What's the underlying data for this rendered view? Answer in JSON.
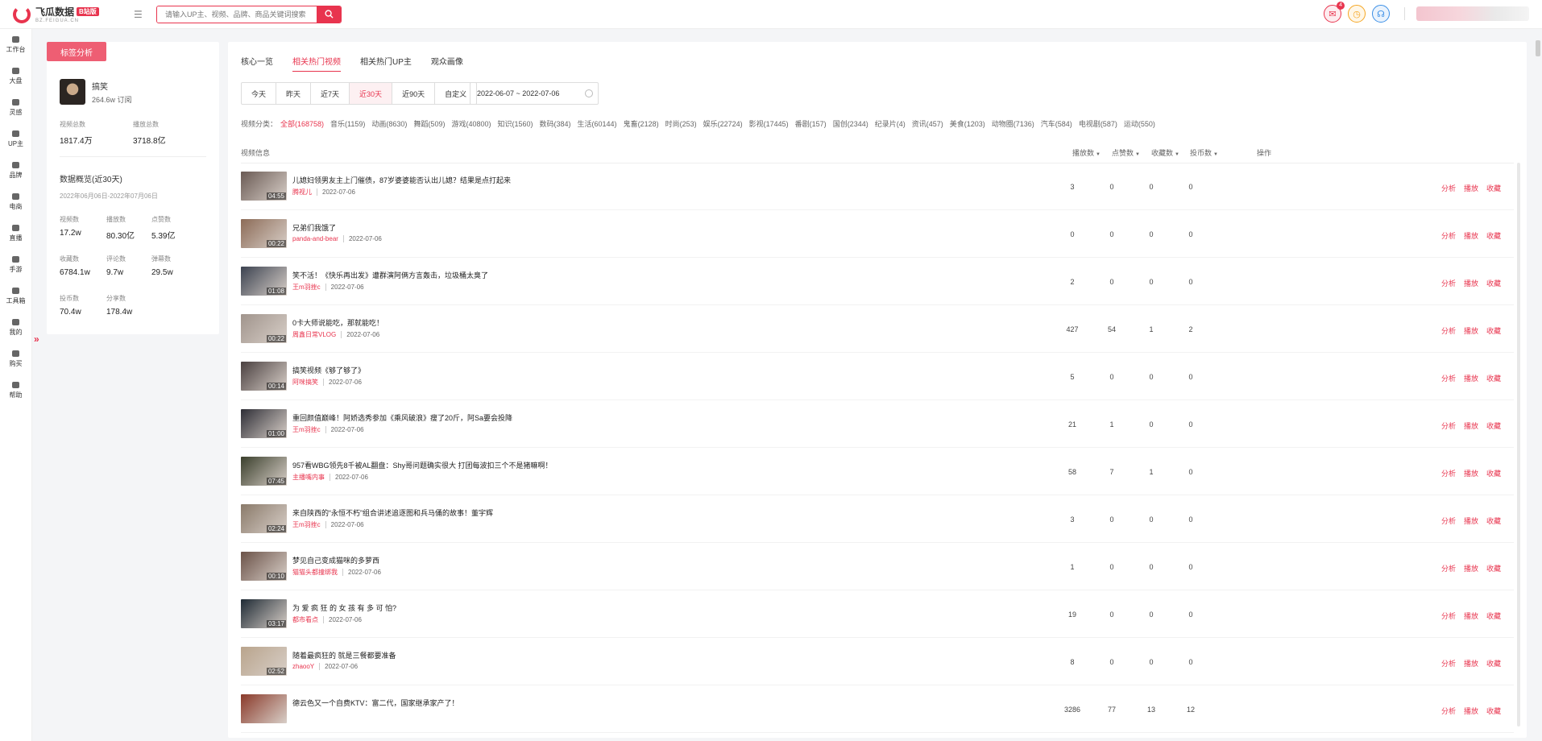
{
  "app": {
    "name": "飞瓜数据",
    "badge": "B站版",
    "domain": "BZ.FEIGUA.CN"
  },
  "search": {
    "placeholder": "请输入UP主、视频、品牌、商品关键词搜索"
  },
  "header": {
    "notif_count": "4"
  },
  "nav": [
    {
      "label": "工作台",
      "icon": "desk-icon"
    },
    {
      "label": "大盘",
      "icon": "globe-icon"
    },
    {
      "label": "灵感",
      "icon": "bulb-icon"
    },
    {
      "label": "UP主",
      "icon": "search-user-icon"
    },
    {
      "label": "品牌",
      "icon": "diamond-icon"
    },
    {
      "label": "电商",
      "icon": "cart-icon"
    },
    {
      "label": "直播",
      "icon": "live-icon"
    },
    {
      "label": "手游",
      "icon": "gamepad-icon"
    },
    {
      "label": "工具箱",
      "icon": "toolbox-icon"
    },
    {
      "label": "我的",
      "icon": "user-icon"
    },
    {
      "label": "购买",
      "icon": "purchase-icon"
    },
    {
      "label": "帮助",
      "icon": "help-icon"
    }
  ],
  "left": {
    "tag_tab": "标签分析",
    "up_name": "搞笑",
    "up_fans": "264.6w 订阅",
    "totals": [
      {
        "key": "视频总数",
        "val": "1817.4万"
      },
      {
        "key": "播放总数",
        "val": "3718.8亿"
      }
    ],
    "overview_title": "数据概览(近30天)",
    "overview_range": "2022年06月06日-2022年07月06日",
    "stats": [
      {
        "key": "视频数",
        "val": "17.2w"
      },
      {
        "key": "播放数",
        "val": "80.30亿"
      },
      {
        "key": "点赞数",
        "val": "5.39亿"
      },
      {
        "key": "收藏数",
        "val": "6784.1w"
      },
      {
        "key": "评论数",
        "val": "9.7w"
      },
      {
        "key": "弹幕数",
        "val": "29.5w"
      },
      {
        "key": "投币数",
        "val": "70.4w"
      },
      {
        "key": "分享数",
        "val": "178.4w"
      }
    ]
  },
  "main": {
    "tabs": [
      "核心一览",
      "相关热门视频",
      "相关热门UP主",
      "观众画像"
    ],
    "active_tab": 1,
    "date_buttons": [
      "今天",
      "昨天",
      "近7天",
      "近30天",
      "近90天",
      "自定义"
    ],
    "active_date": 3,
    "date_range": "2022-06-07 ~ 2022-07-06",
    "category_label": "视频分类：",
    "categories": [
      "全部(168758)",
      "音乐(1159)",
      "动画(8630)",
      "舞蹈(509)",
      "游戏(40800)",
      "知识(1560)",
      "数码(384)",
      "生活(60144)",
      "鬼畜(2128)",
      "时尚(253)",
      "娱乐(22724)",
      "影视(17445)",
      "番剧(157)",
      "国创(2344)",
      "纪录片(4)",
      "资讯(457)",
      "美食(1203)",
      "动物圈(7136)",
      "汽车(584)",
      "电视剧(587)",
      "运动(550)"
    ],
    "columns": {
      "info": "视频信息",
      "play": "播放数",
      "like": "点赞数",
      "fav": "收藏数",
      "coin": "投币数",
      "ops": "操作"
    },
    "ops": [
      "分析",
      "播放",
      "收藏"
    ],
    "rows": [
      {
        "title": "儿媳妇领男友主上门催债，87岁婆婆能否认出儿媳？结果是点打起来",
        "author": "腾视儿",
        "date": "2022-07-06",
        "dur": "04:55",
        "play": "3",
        "like": "0",
        "fav": "0",
        "coin": "0",
        "thumb": "#6a5a54"
      },
      {
        "title": "兄弟们我饿了",
        "author": "panda-and-bear",
        "date": "2022-07-06",
        "dur": "00:22",
        "play": "0",
        "like": "0",
        "fav": "0",
        "coin": "0",
        "thumb": "#8c6b57"
      },
      {
        "title": "笑不活！《快乐再出发》遭群演阿俩方言轰击，垃圾桶太臭了",
        "author": "王m羽挫c",
        "date": "2022-07-06",
        "dur": "01:08",
        "play": "2",
        "like": "0",
        "fav": "0",
        "coin": "0",
        "thumb": "#3b4250"
      },
      {
        "title": "0卡大师说能吃，那就能吃！",
        "author": "周鑫日常VLOG",
        "date": "2022-07-06",
        "dur": "00:22",
        "play": "427",
        "like": "54",
        "fav": "1",
        "coin": "2",
        "thumb": "#a0948c"
      },
      {
        "title": "搞笑视频《够了够了》",
        "author": "阿咪搞笑",
        "date": "2022-07-06",
        "dur": "00:14",
        "play": "5",
        "like": "0",
        "fav": "0",
        "coin": "0",
        "thumb": "#4a4040"
      },
      {
        "title": "重回颜值巅峰！阿娇选秀参加《乘风破浪》瘦了20斤，阿Sa要会投降",
        "author": "王m羽挫c",
        "date": "2022-07-06",
        "dur": "01:00",
        "play": "21",
        "like": "1",
        "fav": "0",
        "coin": "0",
        "thumb": "#2e2e36"
      },
      {
        "title": "957看WBG领先8千被AL翻盘：Shy哥问题确实很大 打团每波扣三个不是猪嘛啊！",
        "author": "主播嘴内事",
        "date": "2022-07-06",
        "dur": "07:45",
        "play": "58",
        "like": "7",
        "fav": "1",
        "coin": "0",
        "thumb": "#3a3f2c"
      },
      {
        "title": "来自陕西的“永恒不朽”组合讲述追逐图和兵马俑的故事！董宇辉",
        "author": "王m羽挫c",
        "date": "2022-07-06",
        "dur": "02:24",
        "play": "3",
        "like": "0",
        "fav": "0",
        "coin": "0",
        "thumb": "#8a7a6a"
      },
      {
        "title": "梦见自己变成猫咪的多萝西",
        "author": "猫猫头都撞绑我",
        "date": "2022-07-06",
        "dur": "00:10",
        "play": "1",
        "like": "0",
        "fav": "0",
        "coin": "0",
        "thumb": "#6b5248"
      },
      {
        "title": "为 爱 疯 狂 的 女 孩 有 多 可 怕?",
        "author": "都市看点",
        "date": "2022-07-06",
        "dur": "03:17",
        "play": "19",
        "like": "0",
        "fav": "0",
        "coin": "0",
        "thumb": "#1e2a34"
      },
      {
        "title": "随着最疯狂的 就是三餐都要准备",
        "author": "zhaooY",
        "date": "2022-07-06",
        "dur": "02:52",
        "play": "8",
        "like": "0",
        "fav": "0",
        "coin": "0",
        "thumb": "#b9a48c"
      },
      {
        "title": "德云色又一个自费KTV：富二代，国家继承家产了！",
        "author": "",
        "date": "",
        "dur": "",
        "play": "3286",
        "like": "77",
        "fav": "13",
        "coin": "12",
        "thumb": "#8a3a2a"
      }
    ]
  }
}
